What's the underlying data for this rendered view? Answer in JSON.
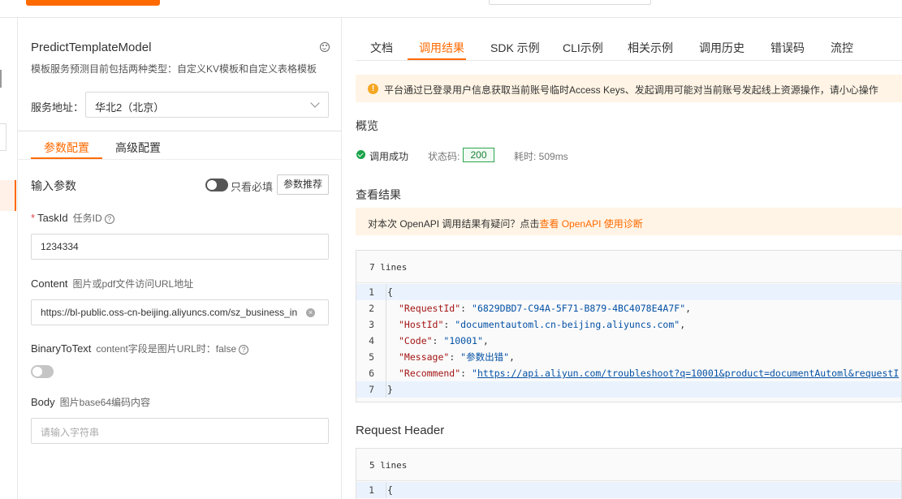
{
  "left_panel": {
    "api_title": "PredictTemplateModel",
    "api_desc": "模板服务预测目前包括两种类型：自定义KV模板和自定义表格模板",
    "service_label": "服务地址：",
    "service_value": "华北2（北京）",
    "tabs": [
      "参数配置",
      "高级配置"
    ],
    "input_params_label": "输入参数",
    "required_only_label": "只看必填",
    "recommend_button": "参数推荐",
    "params": [
      {
        "name": "TaskId",
        "required": true,
        "desc": "任务ID",
        "value": "1234334",
        "placeholder": ""
      },
      {
        "name": "Content",
        "required": false,
        "desc": "图片或pdf文件访问URL地址",
        "value": "https://bl-public.oss-cn-beijing.aliyuncs.com/sz_business_in",
        "placeholder": ""
      },
      {
        "name": "BinaryToText",
        "required": false,
        "desc": "content字段是图片URL时：false"
      },
      {
        "name": "Body",
        "required": false,
        "desc": "图片base64编码内容",
        "value": "",
        "placeholder": "请输入字符串"
      }
    ]
  },
  "right_panel": {
    "tabs": [
      "文档",
      "调用结果",
      "SDK 示例",
      "CLI示例",
      "相关示例",
      "调用历史",
      "错误码",
      "流控"
    ],
    "active_tab": "调用结果",
    "warning": "平台通过已登录用户信息获取当前账号临时Access Keys、发起调用可能对当前账号发起线上资源操作，请小心操作",
    "overview_title": "概览",
    "status_text": "调用成功",
    "status_code_label": "状态码:",
    "status_code": "200",
    "elapsed": "耗时: 509ms",
    "result_title": "查看结果",
    "diag_text": "对本次 OpenAPI 调用结果有疑问？点击",
    "diag_link": "查看 OpenAPI 使用诊断",
    "result_code": {
      "lines_label": "7 lines",
      "lines": [
        {
          "n": "1",
          "text": "{"
        },
        {
          "n": "2",
          "key": "\"RequestId\"",
          "val": "\"6829DBD7-C94A-5F71-B879-4BC4078E4A7F\"",
          "tail": ","
        },
        {
          "n": "3",
          "key": "\"HostId\"",
          "val": "\"documentautoml.cn-beijing.aliyuncs.com\"",
          "tail": ","
        },
        {
          "n": "4",
          "key": "\"Code\"",
          "val": "\"10001\"",
          "tail": ","
        },
        {
          "n": "5",
          "key": "\"Message\"",
          "val": "\"参数出错\"",
          "tail": ","
        },
        {
          "n": "6",
          "key": "\"Recommend\"",
          "val_prefix": "\"",
          "url": "https://api.aliyun.com/troubleshoot?q=10001&product=documentAutoml&requestI"
        },
        {
          "n": "7",
          "text": "}"
        }
      ]
    },
    "header_title": "Request Header",
    "header_code": {
      "lines_label": "5 lines",
      "lines": [
        {
          "n": "1",
          "text": "{"
        }
      ]
    }
  },
  "colors": {
    "accent": "#ff6a00",
    "success": "#1aa34a",
    "warning_bg": "#fff4e5"
  }
}
